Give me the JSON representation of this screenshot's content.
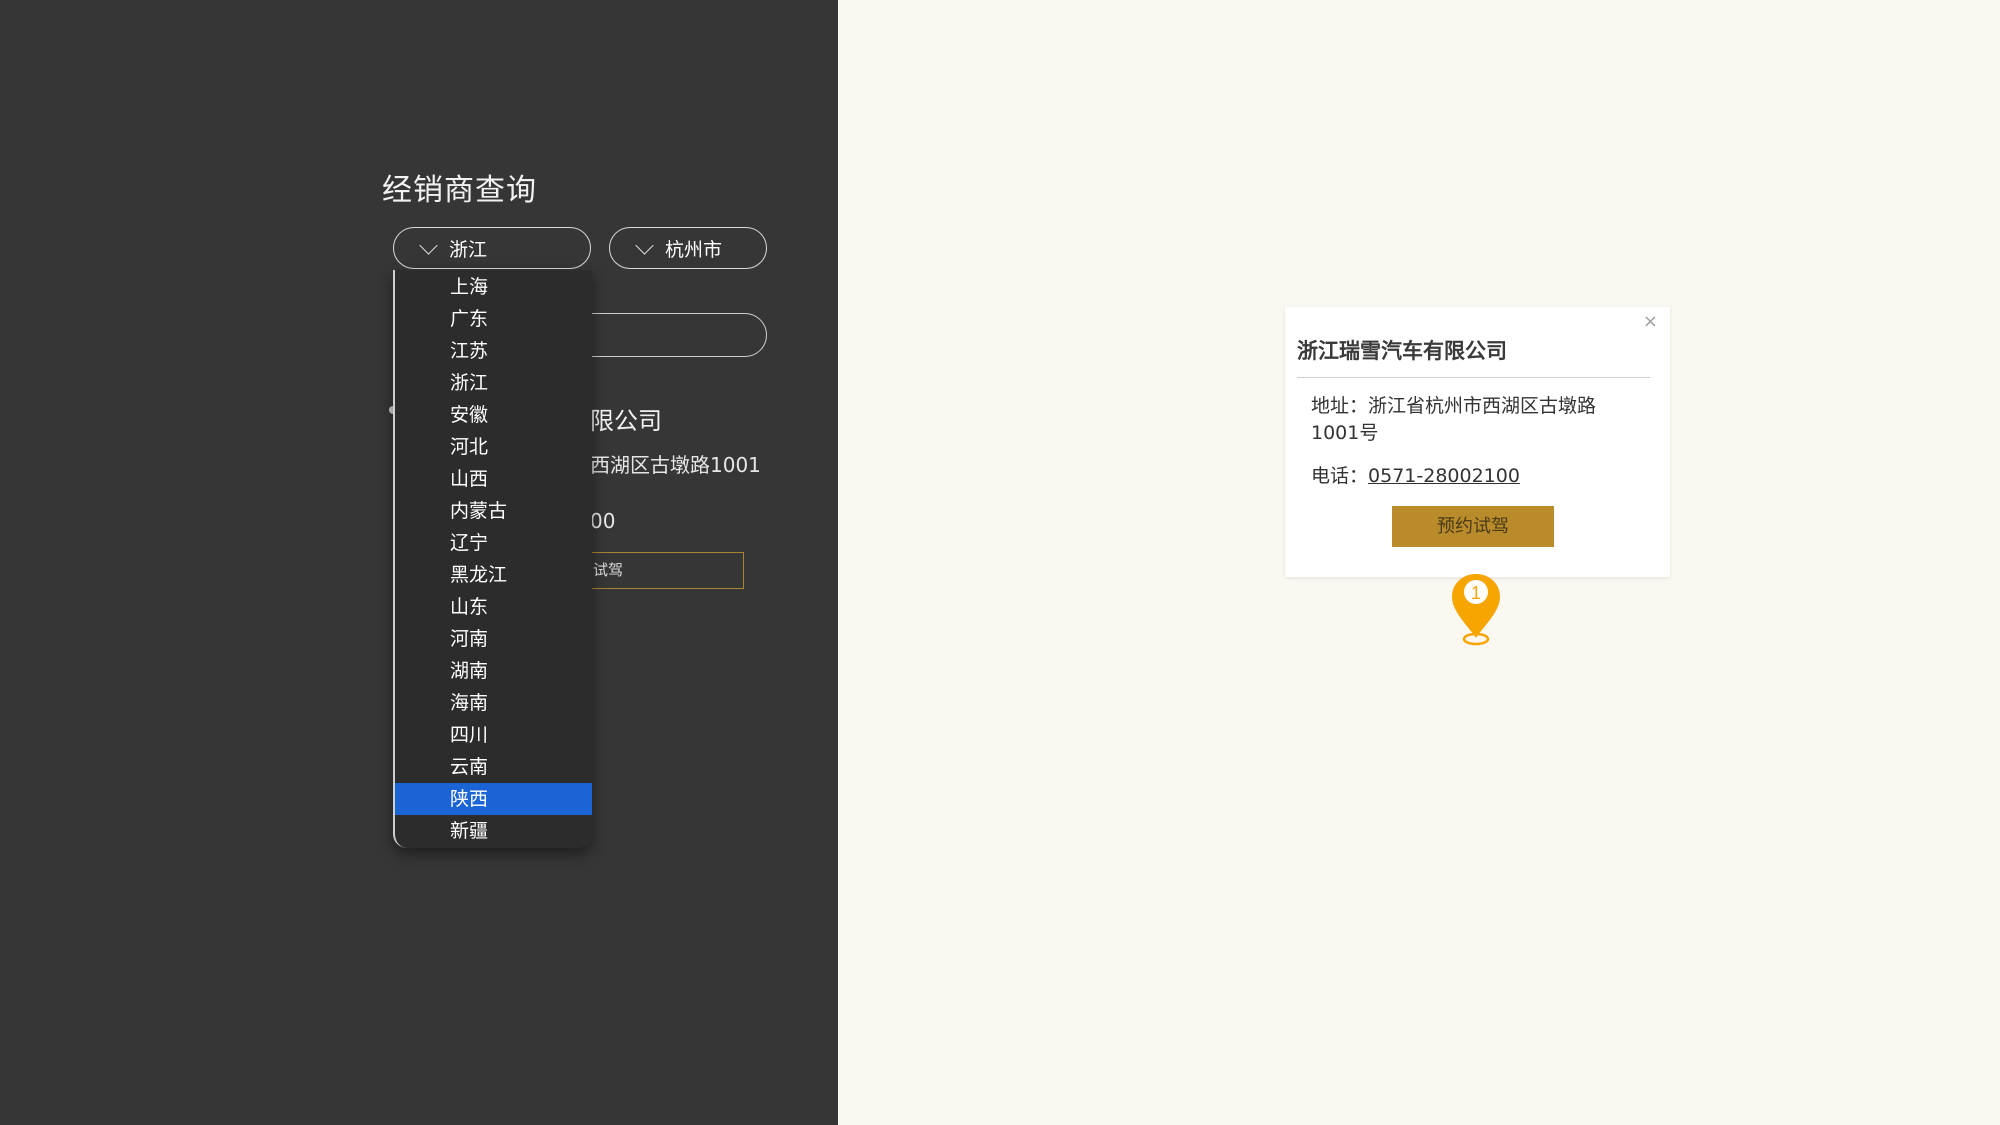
{
  "page": {
    "title": "经销商查询"
  },
  "filters": {
    "province": "浙江",
    "city": "杭州市"
  },
  "province_dropdown": {
    "options": [
      "上海",
      "广东",
      "江苏",
      "浙江",
      "安徽",
      "河北",
      "山西",
      "内蒙古",
      "辽宁",
      "黑龙江",
      "山东",
      "河南",
      "湖南",
      "海南",
      "四川",
      "云南",
      "陕西",
      "新疆"
    ],
    "highlighted": "陕西"
  },
  "dealer_list_visible": {
    "name_fragment": "限公司",
    "address_fragment": "西湖区古墩路1001",
    "phone_fragment": "00",
    "button_fragment": "试驾"
  },
  "map_popup": {
    "title": "浙江瑞雪汽车有限公司",
    "address_label": "地址：",
    "address": "浙江省杭州市西湖区古墩路1001号",
    "phone_label": "电话：",
    "phone": "0571-28002100",
    "button_label": "预约试驾",
    "close_symbol": "×"
  },
  "map_marker": {
    "number": "1",
    "color": "#f5a400"
  },
  "colors": {
    "left_bg": "#363636",
    "right_bg": "#fbf8f2",
    "accent": "#b98b2a",
    "highlight": "#1a64d6"
  }
}
